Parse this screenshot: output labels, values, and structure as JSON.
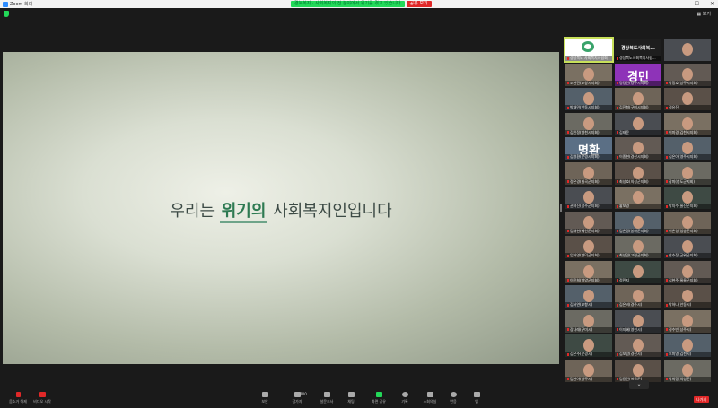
{
  "window": {
    "title": "Zoom 회의",
    "controls": [
      "—",
      "☐",
      "✕"
    ]
  },
  "share_banner": {
    "message": "경북복지 · 사회복지의 전 분야에서 위기를 겪고 있습니다",
    "stop_label": "공유 보기"
  },
  "topbar": {
    "view_label": "보기"
  },
  "slide": {
    "before": "우리는 ",
    "highlight": "위기의",
    "after": " 사회복지인입니다"
  },
  "gallery": {
    "tiles": [
      {
        "name": "경상북도 사회복지사협회",
        "kind": "logo",
        "active": true
      },
      {
        "name": "경상북도사회복지사협...",
        "kind": "text",
        "big": "경상북도사회복..."
      },
      {
        "name": "",
        "kind": "video"
      },
      {
        "name": "조현진(포항시지회)",
        "kind": "video"
      },
      {
        "name": "정경민(경주시지회)",
        "kind": "avatar",
        "big": "경민"
      },
      {
        "name": "박정호(상주시지회)",
        "kind": "video"
      },
      {
        "name": "박재민(안동시지회)",
        "kind": "video"
      },
      {
        "name": "김진형(구미시지회)",
        "kind": "video"
      },
      {
        "name": "정유진",
        "kind": "video"
      },
      {
        "name": "김민정(영천시지회)",
        "kind": "video"
      },
      {
        "name": "김태윤",
        "kind": "video"
      },
      {
        "name": "이미경(김천시지회)",
        "kind": "video"
      },
      {
        "name": "김명환(문경시지회)",
        "kind": "avatar",
        "big": "명환"
      },
      {
        "name": "이종현(경산시지회)",
        "kind": "video"
      },
      {
        "name": "김은아(영주시지회)",
        "kind": "video"
      },
      {
        "name": "정은경(칠곡군지회)",
        "kind": "video"
      },
      {
        "name": "최성호(의성군지회)",
        "kind": "video"
      },
      {
        "name": "장미(청도군지회)",
        "kind": "video"
      },
      {
        "name": "권혁진(성주군지회)",
        "kind": "video"
      },
      {
        "name": "황보경",
        "kind": "video"
      },
      {
        "name": "박지수(울진군지회)",
        "kind": "video"
      },
      {
        "name": "김태현(예천군지회)",
        "kind": "video"
      },
      {
        "name": "김은정(봉화군지회)",
        "kind": "video"
      },
      {
        "name": "이은영(청송군지회)",
        "kind": "video"
      },
      {
        "name": "임하영(영덕군지회)",
        "kind": "video"
      },
      {
        "name": "최성민(고령군지회)",
        "kind": "video"
      },
      {
        "name": "한수정(군위군지회)",
        "kind": "video"
      },
      {
        "name": "이윤희(영양군지회)",
        "kind": "video"
      },
      {
        "name": "정민지",
        "kind": "video"
      },
      {
        "name": "김현주(울릉군지회)",
        "kind": "video"
      },
      {
        "name": "김서연(포항시)",
        "kind": "video"
      },
      {
        "name": "김은비(경주시)",
        "kind": "video"
      },
      {
        "name": "박하나(안동시)",
        "kind": "video"
      },
      {
        "name": "강나래(구미시)",
        "kind": "video"
      },
      {
        "name": "이지혜(영천시)",
        "kind": "video"
      },
      {
        "name": "정수빈(상주시)",
        "kind": "video"
      },
      {
        "name": "김은주(문경시)",
        "kind": "video"
      },
      {
        "name": "김보람(경산시)",
        "kind": "video"
      },
      {
        "name": "오미영(김천시)",
        "kind": "video"
      },
      {
        "name": "김현아(영주시)",
        "kind": "video"
      },
      {
        "name": "김용민(칠곡군)",
        "kind": "video"
      },
      {
        "name": "박희정(의성군)",
        "kind": "video"
      }
    ]
  },
  "toolbar": {
    "left": [
      {
        "label": "음소거 해제",
        "icon": "mic-muted-icon"
      },
      {
        "label": "비디오 시작",
        "icon": "video-off-icon"
      }
    ],
    "center": [
      {
        "label": "보안",
        "icon": "shield-icon"
      },
      {
        "label": "참가자",
        "icon": "participants-icon",
        "count": "100"
      },
      {
        "label": "설문조사",
        "icon": "poll-icon"
      },
      {
        "label": "채팅",
        "icon": "chat-icon"
      },
      {
        "label": "화면 공유",
        "icon": "share-screen-icon"
      },
      {
        "label": "기록",
        "icon": "record-icon"
      },
      {
        "label": "소회의실",
        "icon": "breakout-icon"
      },
      {
        "label": "반응",
        "icon": "reaction-icon"
      },
      {
        "label": "앱",
        "icon": "apps-icon"
      }
    ],
    "end_label": "나가기"
  },
  "colors": {
    "share_green": "#23d959",
    "danger_red": "#e02828",
    "active_speaker": "#c8e05a",
    "slide_highlight": "#2e7a52"
  }
}
